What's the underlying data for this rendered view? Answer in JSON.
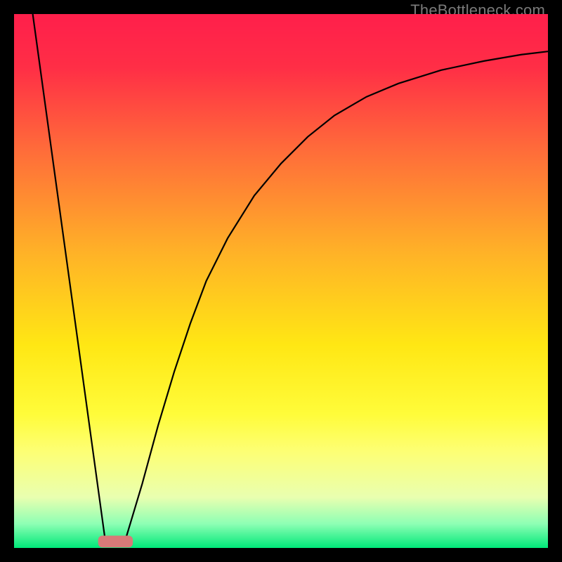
{
  "watermark": {
    "text": "TheBottleneck.com"
  },
  "chart_data": {
    "type": "line",
    "title": "",
    "xlabel": "",
    "ylabel": "",
    "xlim": [
      0,
      100
    ],
    "ylim": [
      0,
      100
    ],
    "grid": false,
    "legend": false,
    "background_gradient_stops": [
      {
        "offset": 0.0,
        "color": "#ff1f4b"
      },
      {
        "offset": 0.1,
        "color": "#ff2e46"
      },
      {
        "offset": 0.25,
        "color": "#ff6a3a"
      },
      {
        "offset": 0.45,
        "color": "#ffb327"
      },
      {
        "offset": 0.62,
        "color": "#ffe714"
      },
      {
        "offset": 0.75,
        "color": "#fffc3a"
      },
      {
        "offset": 0.82,
        "color": "#fdff75"
      },
      {
        "offset": 0.905,
        "color": "#e9ffb0"
      },
      {
        "offset": 0.955,
        "color": "#8dffb4"
      },
      {
        "offset": 1.0,
        "color": "#00e879"
      }
    ],
    "series": [
      {
        "name": "left-falling-line",
        "x": [
          3.5,
          17.0
        ],
        "y": [
          100,
          2
        ],
        "stroke": "#000000",
        "comment": "steep straight descent from top-left to valley"
      },
      {
        "name": "right-rising-curve",
        "x": [
          21,
          24,
          27,
          30,
          33,
          36,
          40,
          45,
          50,
          55,
          60,
          66,
          72,
          80,
          88,
          95,
          100
        ],
        "y": [
          2,
          12,
          23,
          33,
          42,
          50,
          58,
          66,
          72,
          77,
          81,
          84.5,
          87,
          89.5,
          91.2,
          92.4,
          93
        ],
        "stroke": "#000000",
        "comment": "concave curve rising from valley toward upper-right, flattening"
      }
    ],
    "marker": {
      "name": "valley-marker",
      "shape": "rounded-rect",
      "cx": 19.0,
      "cy": 1.2,
      "width": 6.5,
      "height": 2.2,
      "fill": "#d77a78"
    }
  }
}
